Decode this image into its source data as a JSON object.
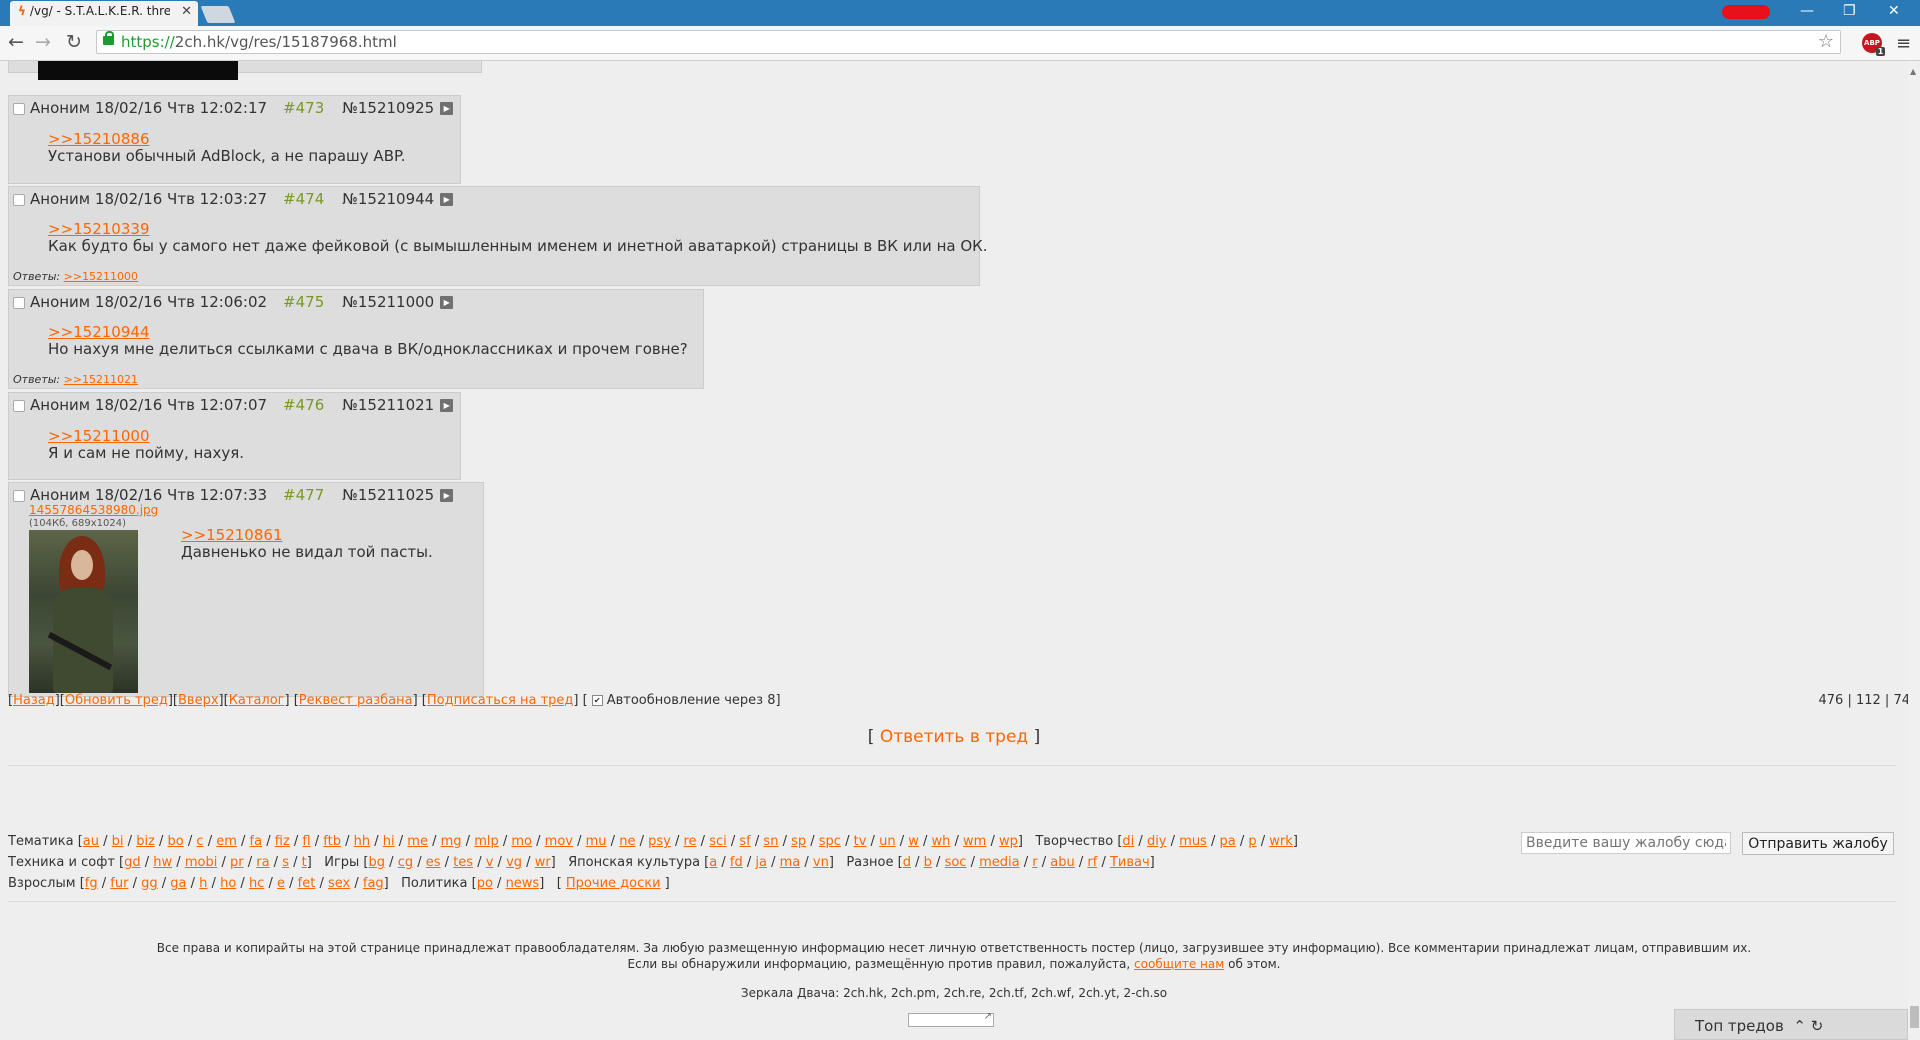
{
  "browser": {
    "tab_title": "/vg/ - S.T.A.L.K.E.R. thread",
    "url_scheme": "https://",
    "url_rest": "2ch.hk/vg/res/15187968.html",
    "abp_label": "ABP",
    "abp_count": "1"
  },
  "posts": [
    {
      "author": "Аноним",
      "date": "18/02/16 Чтв 12:02:17",
      "num": "#473",
      "id": "№15210925",
      "link": ">>15210886",
      "text": "Установи обычный AdBlock, а не парашу ABP.",
      "replies_label": "",
      "reply_link": ""
    },
    {
      "author": "Аноним",
      "date": "18/02/16 Чтв 12:03:27",
      "num": "#474",
      "id": "№15210944",
      "link": ">>15210339",
      "text": "Как будто бы у самого нет даже фейковой (с вымышленным именем и инетной аватаркой) страницы в ВК или на ОК.",
      "replies_label": "Ответы:",
      "reply_link": ">>15211000"
    },
    {
      "author": "Аноним",
      "date": "18/02/16 Чтв 12:06:02",
      "num": "#475",
      "id": "№15211000",
      "link": ">>15210944",
      "text": "Но нахуя мне делиться ссылками с двача в ВК/одноклассниках и прочем говне?",
      "replies_label": "Ответы:",
      "reply_link": ">>15211021"
    },
    {
      "author": "Аноним",
      "date": "18/02/16 Чтв 12:07:07",
      "num": "#476",
      "id": "№15211021",
      "link": ">>15211000",
      "text": "Я и сам не пойму, нахуя.",
      "replies_label": "",
      "reply_link": ""
    },
    {
      "author": "Аноним",
      "date": "18/02/16 Чтв 12:07:33",
      "num": "#477",
      "id": "№15211025",
      "link": ">>15210861",
      "text": "Давненько не видал той пасты.",
      "file_name": "14557864538980.jpg",
      "file_meta": "(104Кб, 689x1024)"
    }
  ],
  "navline": {
    "back": "Назад",
    "refresh": "Обновить тред",
    "up": "Вверх",
    "catalog": "Каталог",
    "ban_request": "Реквест разбана",
    "subscribe": "Подписаться на тред",
    "autoupdate": "Автообновление через 8"
  },
  "counts": {
    "posts": "476",
    "images": "112",
    "unique": "74"
  },
  "reply_link": "Ответить в тред",
  "board_groups": {
    "tematika": {
      "label": "Тематика",
      "boards": [
        "au",
        "bi",
        "biz",
        "bo",
        "c",
        "em",
        "fa",
        "fiz",
        "fl",
        "ftb",
        "hh",
        "hi",
        "me",
        "mg",
        "mlp",
        "mo",
        "mov",
        "mu",
        "ne",
        "psy",
        "re",
        "sci",
        "sf",
        "sn",
        "sp",
        "spc",
        "tv",
        "un",
        "w",
        "wh",
        "wm",
        "wp"
      ]
    },
    "tvorchestvo": {
      "label": "Творчество",
      "boards": [
        "di",
        "diy",
        "mus",
        "pa",
        "p",
        "wrk"
      ]
    },
    "tech": {
      "label": "Техника и софт",
      "boards": [
        "gd",
        "hw",
        "mobi",
        "pr",
        "ra",
        "s",
        "t"
      ]
    },
    "games": {
      "label": "Игры",
      "boards": [
        "bg",
        "cg",
        "es",
        "tes",
        "v",
        "vg",
        "wr"
      ]
    },
    "japan": {
      "label": "Японская культура",
      "boards": [
        "a",
        "fd",
        "ja",
        "ma",
        "vn"
      ]
    },
    "misc": {
      "label": "Разное",
      "boards": [
        "d",
        "b",
        "soc",
        "media",
        "r",
        "abu",
        "rf",
        "Тивач"
      ]
    },
    "adult": {
      "label": "Взрослым",
      "boards": [
        "fg",
        "fur",
        "gg",
        "ga",
        "h",
        "ho",
        "hc",
        "e",
        "fet",
        "sex",
        "fag"
      ]
    },
    "politics": {
      "label": "Политика",
      "boards": [
        "po",
        "news"
      ]
    },
    "other": {
      "label": "Прочие доски"
    }
  },
  "complaint": {
    "placeholder": "Введите вашу жалобу сюда",
    "button": "Отправить жалобу"
  },
  "footer": {
    "line1": "Все права и копирайты на этой странице принадлежат правообладателям. За любую размещенную информацию несет личную ответственность постер (лицо, загрузившее эту информацию). Все комментарии принадлежат лицам, отправившим их.",
    "line2_pre": "Если вы обнаружили информацию, размещённую против правил, пожалуйста,",
    "line2_link": "сообщите нам",
    "line2_post": "об этом.",
    "mirrors": "Зеркала Двача: 2ch.hk, 2ch.pm, 2ch.re, 2ch.tf, 2ch.wf, 2ch.yt, 2-ch.so"
  },
  "top_threads": "Топ тредов"
}
